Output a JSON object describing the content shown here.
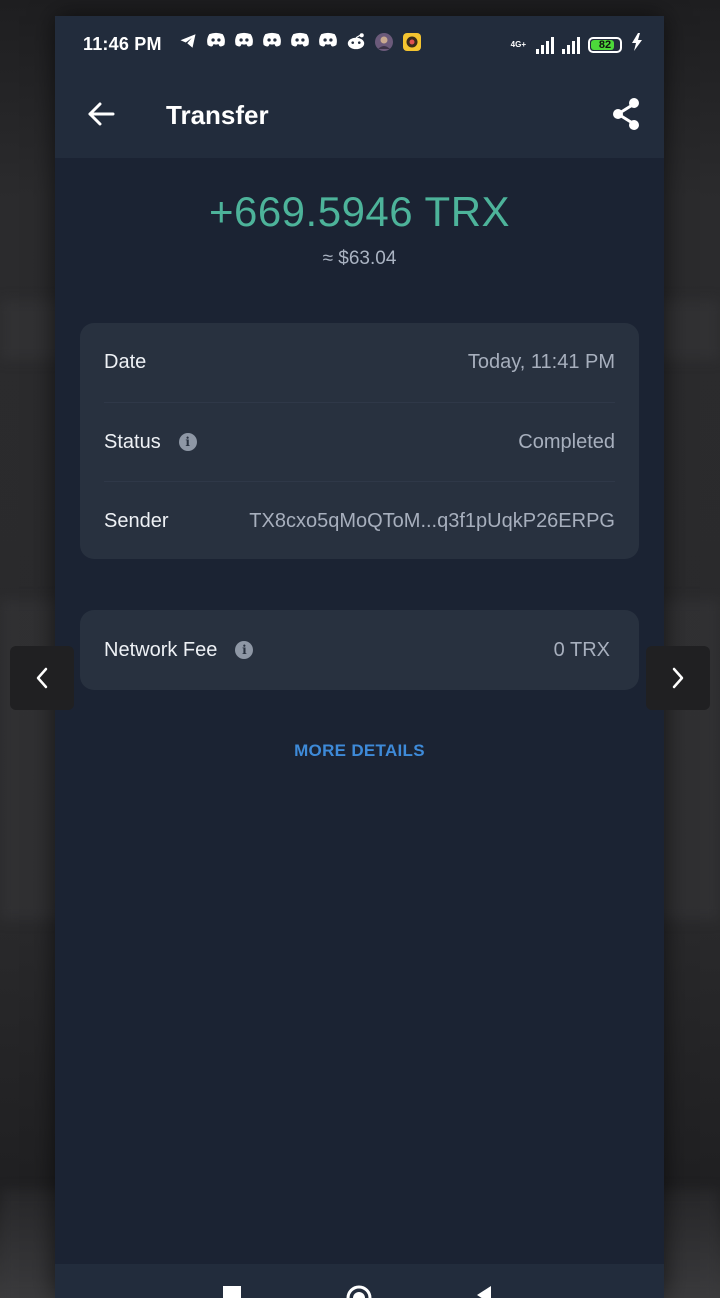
{
  "status_bar": {
    "time": "11:46 PM",
    "network_label": "4G+",
    "battery_percent": "82",
    "battery_level": 0.82,
    "battery_color": "#4cd93a",
    "notification_icons": [
      "telegram-icon",
      "discord-icon",
      "discord-icon",
      "discord-icon",
      "discord-icon",
      "discord-icon",
      "reddit-icon",
      "avatar-icon",
      "camera-app-icon"
    ]
  },
  "app_bar": {
    "title": "Transfer",
    "back_icon": "arrow-left-icon",
    "share_icon": "share-icon"
  },
  "transaction": {
    "amount": "+669.5946 TRX",
    "fiat_value": "≈ $63.04",
    "amount_color": "#4db39a"
  },
  "details": {
    "date_label": "Date",
    "date_value": "Today, 11:41 PM",
    "status_label": "Status",
    "status_value": "Completed",
    "sender_label": "Sender",
    "sender_value": "TX8cxo5qMoQToM...q3f1pUqkP26ERPG"
  },
  "fee": {
    "label": "Network Fee",
    "value": "0 TRX"
  },
  "more_details": {
    "label": "MORE DETAILS",
    "color": "#3e8ad8"
  },
  "overlay": {
    "prev_icon": "chevron-left-icon",
    "next_icon": "chevron-right-icon"
  }
}
